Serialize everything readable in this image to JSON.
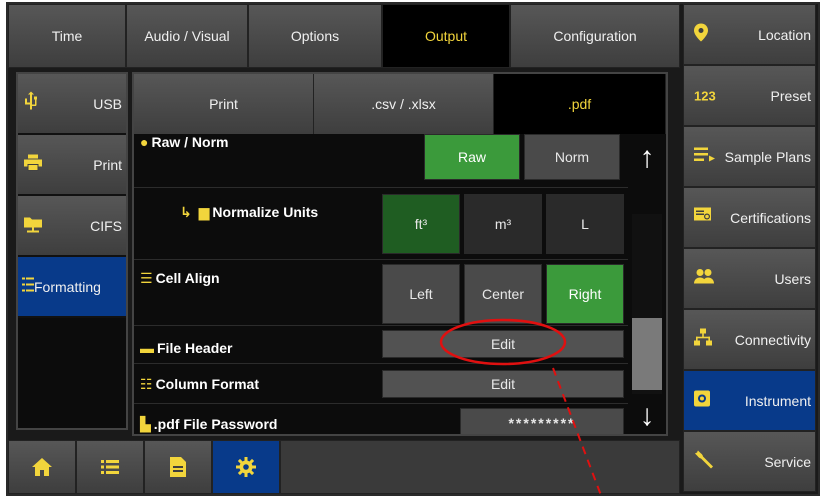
{
  "top_tabs": [
    {
      "label": "Time"
    },
    {
      "label": "Audio / Visual"
    },
    {
      "label": "Options"
    },
    {
      "label": "Output"
    },
    {
      "label": "Configuration"
    }
  ],
  "right_nav": [
    {
      "label": "Location",
      "icon": "location-pin-icon"
    },
    {
      "label": "Preset",
      "icon": "123"
    },
    {
      "label": "Sample Plans",
      "icon": "sample-plans-icon"
    },
    {
      "label": "Certifications",
      "icon": "certificate-icon"
    },
    {
      "label": "Users",
      "icon": "users-icon"
    },
    {
      "label": "Connectivity",
      "icon": "network-icon"
    },
    {
      "label": "Instrument",
      "icon": "instrument-icon"
    },
    {
      "label": "Service",
      "icon": "wrench-icon"
    }
  ],
  "left_nav": [
    {
      "label": "USB",
      "icon": "usb-icon"
    },
    {
      "label": "Print",
      "icon": "printer-icon"
    },
    {
      "label": "CIFS",
      "icon": "network-folder-icon"
    },
    {
      "label": "Formatting",
      "icon": "list-format-icon"
    }
  ],
  "sub_tabs": [
    {
      "label": "Print"
    },
    {
      "label": ".csv / .xlsx"
    },
    {
      "label": ".pdf"
    }
  ],
  "rows": {
    "raw_norm": {
      "label": "Raw / Norm",
      "options": [
        "Raw",
        "Norm"
      ],
      "selected": "Raw"
    },
    "normalize_units": {
      "label": "Normalize Units",
      "options": [
        "ft³",
        "m³",
        "L"
      ],
      "selected": "ft³"
    },
    "cell_align": {
      "label": "Cell Align",
      "options": [
        "Left",
        "Center",
        "Right"
      ],
      "selected": "Right"
    },
    "file_header": {
      "label": "File Header",
      "button": "Edit"
    },
    "column_format": {
      "label": "Column Format",
      "button": "Edit"
    },
    "pdf_password": {
      "label": ".pdf File Password",
      "value": "*********"
    }
  },
  "bottom_bar": [
    {
      "icon": "home-icon"
    },
    {
      "icon": "list-icon"
    },
    {
      "icon": "document-icon"
    },
    {
      "icon": "gear-icon"
    }
  ],
  "colors": {
    "accent_yellow": "#f2d53c",
    "active_blue": "#083a8a",
    "selected_green": "#3b9a3b",
    "annotation_red": "#e01010"
  }
}
